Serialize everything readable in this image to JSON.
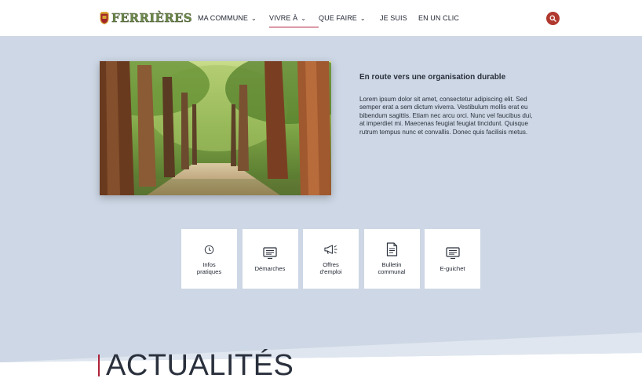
{
  "header": {
    "logo_text": "FERRIÈRES",
    "nav": [
      {
        "label": "MA COMMUNE",
        "has_dropdown": true
      },
      {
        "label": "VIVRE À",
        "has_dropdown": true,
        "active": true
      },
      {
        "label": "QUE FAIRE",
        "has_dropdown": true
      },
      {
        "label": "JE SUIS",
        "has_dropdown": false
      },
      {
        "label": "EN UN CLIC",
        "has_dropdown": false
      }
    ],
    "search_icon": "search-icon"
  },
  "hero": {
    "image": "forest-path-photo",
    "title": "En route vers une organisation durable",
    "text": "Lorem ipsum dolor sit amet, consectetur adipiscing elit. Sed semper erat a sem dictum viverra. Vestibulum mollis erat eu bibendum sagittis. Etiam nec arcu orci. Nunc vel faucibus dui, at imperdiet mi. Maecenas feugiat feugiat tincidunt. Quisque rutrum tempus nunc et convallis. Donec quis facilisis metus."
  },
  "tiles": [
    {
      "label": "Infos\npratiques",
      "icon": "clock-icon"
    },
    {
      "label": "Démarches",
      "icon": "monitor-icon"
    },
    {
      "label": "Offres\nd'emploi",
      "icon": "megaphone-icon"
    },
    {
      "label": "Bulletin\ncommunal",
      "icon": "document-icon"
    },
    {
      "label": "E-guichet",
      "icon": "monitor-icon"
    }
  ],
  "news": {
    "title": "ACTUALITÉS"
  },
  "colors": {
    "accent": "#b0213a",
    "band": "#cdd7e5",
    "search": "#b0382e"
  }
}
